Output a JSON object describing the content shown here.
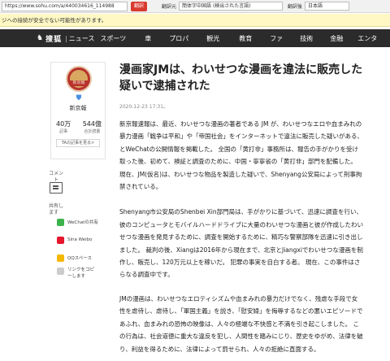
{
  "browser": {
    "url": "https://www.sohu.com/a/440034616_114988",
    "translate_button": "翻訳",
    "source_label": "翻訳元",
    "source_language": "簡体字中国語 (検出された言語)",
    "target_label": "翻訳後",
    "target_language": "日本語"
  },
  "warning": "ジへの接続が安全でない可能性があります。",
  "nav": {
    "logo": "搜狐",
    "logo_icon": "fox-icon",
    "items": [
      "ニュース",
      "スポーツ",
      "車",
      "プロパ",
      "観光",
      "教育",
      "ファ",
      "技術",
      "金融",
      "エンタ"
    ]
  },
  "sidebar": {
    "avatar_text": "新京報",
    "verified_icon": "shield-icon",
    "source_name": "新京報",
    "stats": [
      {
        "value": "40万",
        "label": "記事"
      },
      {
        "value": "544億",
        "label": "合計読書"
      }
    ],
    "more_link": "TAの記事を見る>"
  },
  "actions": {
    "comment_label": "コメン\nト",
    "share_label": "共有し\nます",
    "share_items": [
      {
        "label": "WeChatの共有",
        "icon": "wechat-icon",
        "color": "#3bb34a"
      },
      {
        "label": "Sina Weibo",
        "icon": "weibo-icon",
        "color": "#e6162d"
      },
      {
        "label": "QQスペース",
        "icon": "qzone-icon",
        "color": "#f5b800"
      },
      {
        "label": "リンクをコピーします",
        "icon": "link-icon",
        "color": "#999999"
      }
    ]
  },
  "article": {
    "title": "漫画家JMは、わいせつな漫画を違法に販売した疑いで逮捕された",
    "date": "2020-12-23 17:31。",
    "paragraphs": [
      "新京報速報は、最近、わいせつな漫画の著者である JM が、わいせつなエロや血まみれの暴力漫画「戦争は平和」や「帝国社会」をインターネットで違法に販売した疑いがある、とWeChatの公開情報を掲載した。 全国の「黄打非」事務所は、報告の手がかりを受け取った後、初めて、検証と調査のために、中国・寧寧省の「黄打非」部門を配備した。 現在、JM(仮名)は、わいせつな物品を製造した疑いで、Shenyang公安局によって刑事拘禁されている。",
      "Shenyang市公安局のShenbei Xin部門局は、手がかりに基づいて、迅速に調査を行い、彼のコンピュータとモバイルハードドライブに大量のわいせつな漫画と彼が作成したわいせつな漫画を発見するために、調査を開始するために、精巧な警察部隊を迅速に引き出しました。 裁判の後、Xiangは2016年から現在まで、北京とJiangxiでわいせつな漫画を制作し、販売し、120万元以上を稼いだ。 犯罪の事実を自白する者。 現在、この事件はさらなる調査中です。",
      "JMの漫画は、わいせつなエロティシズムや血まみれの暴力だけでなく、残虐な手段で女性を虐待し、虐待し、「軍国主義」を説き、「慰安婦」を侮辱するなどの悪いエピソードであふれ、血まみれの恐怖の映像は、人々の極端な不快感と不満を引き起こしました。 この行為は、社会道徳に重大な違反を犯し、人間性を踏みにじり、歴史をゆがめ、法律を破り、利益を得るために、法律によって罰せられ、人々の拒絶に直面する。"
    ]
  }
}
